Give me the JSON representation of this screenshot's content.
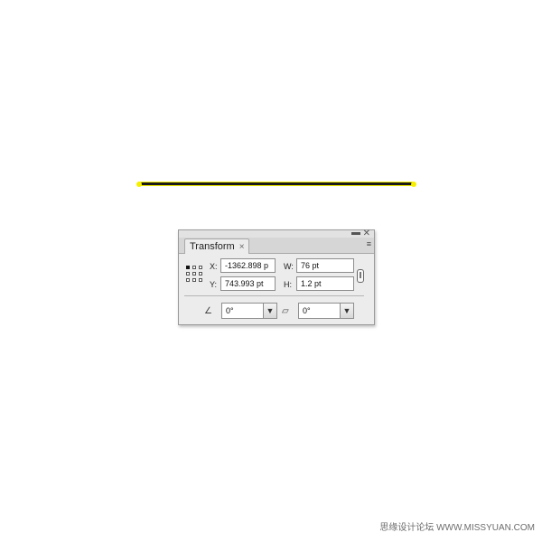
{
  "panel": {
    "tab_label": "Transform",
    "tab_close_icon": "×",
    "close_icon": "✕",
    "minimize_icon": "▬",
    "menu_icon": "≡",
    "x_label": "X:",
    "x_value": "-1362.898 p",
    "y_label": "Y:",
    "y_value": "743.993 pt",
    "w_label": "W:",
    "w_value": "76 pt",
    "h_label": "H:",
    "h_value": "1.2 pt",
    "rotate_icon": "∠",
    "rotate_value": "0°",
    "shear_icon": "⏥",
    "shear_value": "0°"
  },
  "watermark": "思缘设计论坛 WWW.MISSYUAN.COM",
  "colors": {
    "line": "#1a1a1a",
    "anchor": "#f6f000",
    "panel_bg": "#ececec"
  }
}
